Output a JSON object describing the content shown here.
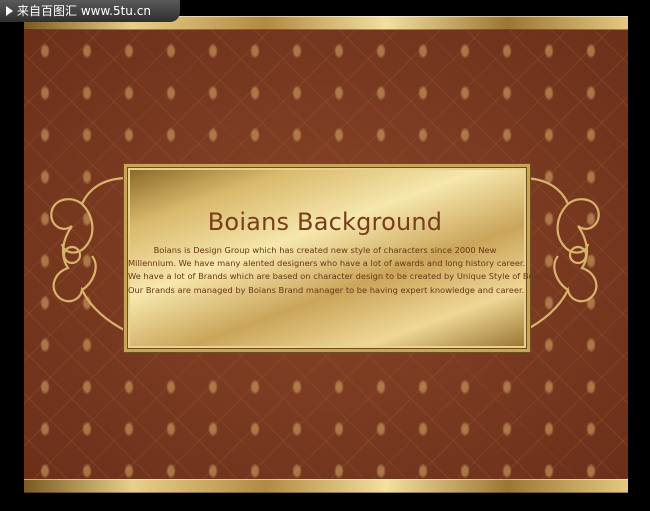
{
  "watermark": {
    "text": "来自百图汇 www.5tu.cn",
    "icon": "play-triangle-icon"
  },
  "banner": {
    "title": "Boians Background",
    "lines": [
      "Boians is Design Group which has created new style of characters since 2000 New",
      "Millennium. We have many alented designers who have a lot of awards and long history career.",
      "We have a lot of Brands which are based on character design to be created by Unique Style of Boians.",
      "Our Brands are managed by Boians Brand manager to be having expert knowledge and career."
    ]
  },
  "colors": {
    "background": "#7d3b22",
    "gold": "#d9b96c",
    "title_text": "#7a3d1c"
  }
}
